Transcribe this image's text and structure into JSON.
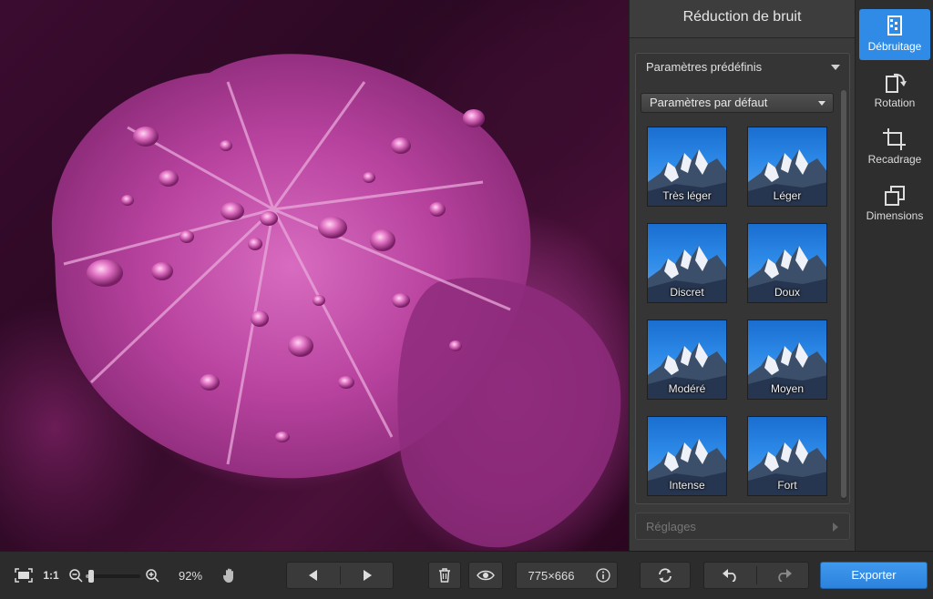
{
  "panel": {
    "title": "Réduction de bruit",
    "presets_section": "Paramètres prédéfinis",
    "preset_dropdown": "Paramètres par défaut",
    "thumbnails": [
      {
        "label": "Très léger"
      },
      {
        "label": "Léger"
      },
      {
        "label": "Discret"
      },
      {
        "label": "Doux"
      },
      {
        "label": "Modéré"
      },
      {
        "label": "Moyen"
      },
      {
        "label": "Intense"
      },
      {
        "label": "Fort"
      }
    ],
    "settings_section": "Réglages"
  },
  "tools": [
    {
      "label": "Débruitage",
      "icon": "denoise-icon",
      "active": true
    },
    {
      "label": "Rotation",
      "icon": "rotation-icon",
      "active": false
    },
    {
      "label": "Recadrage",
      "icon": "crop-icon",
      "active": false
    },
    {
      "label": "Dimensions",
      "icon": "resize-icon",
      "active": false
    }
  ],
  "toolbar": {
    "actual_size": "1:1",
    "zoom": "92%",
    "zoom_level": 0.1,
    "dimensions": "775×666",
    "export": "Exporter"
  },
  "colors": {
    "accent": "#2f8be6",
    "panel_bg": "#3a3a3a",
    "toolbar_bg": "#2c2c2c"
  }
}
